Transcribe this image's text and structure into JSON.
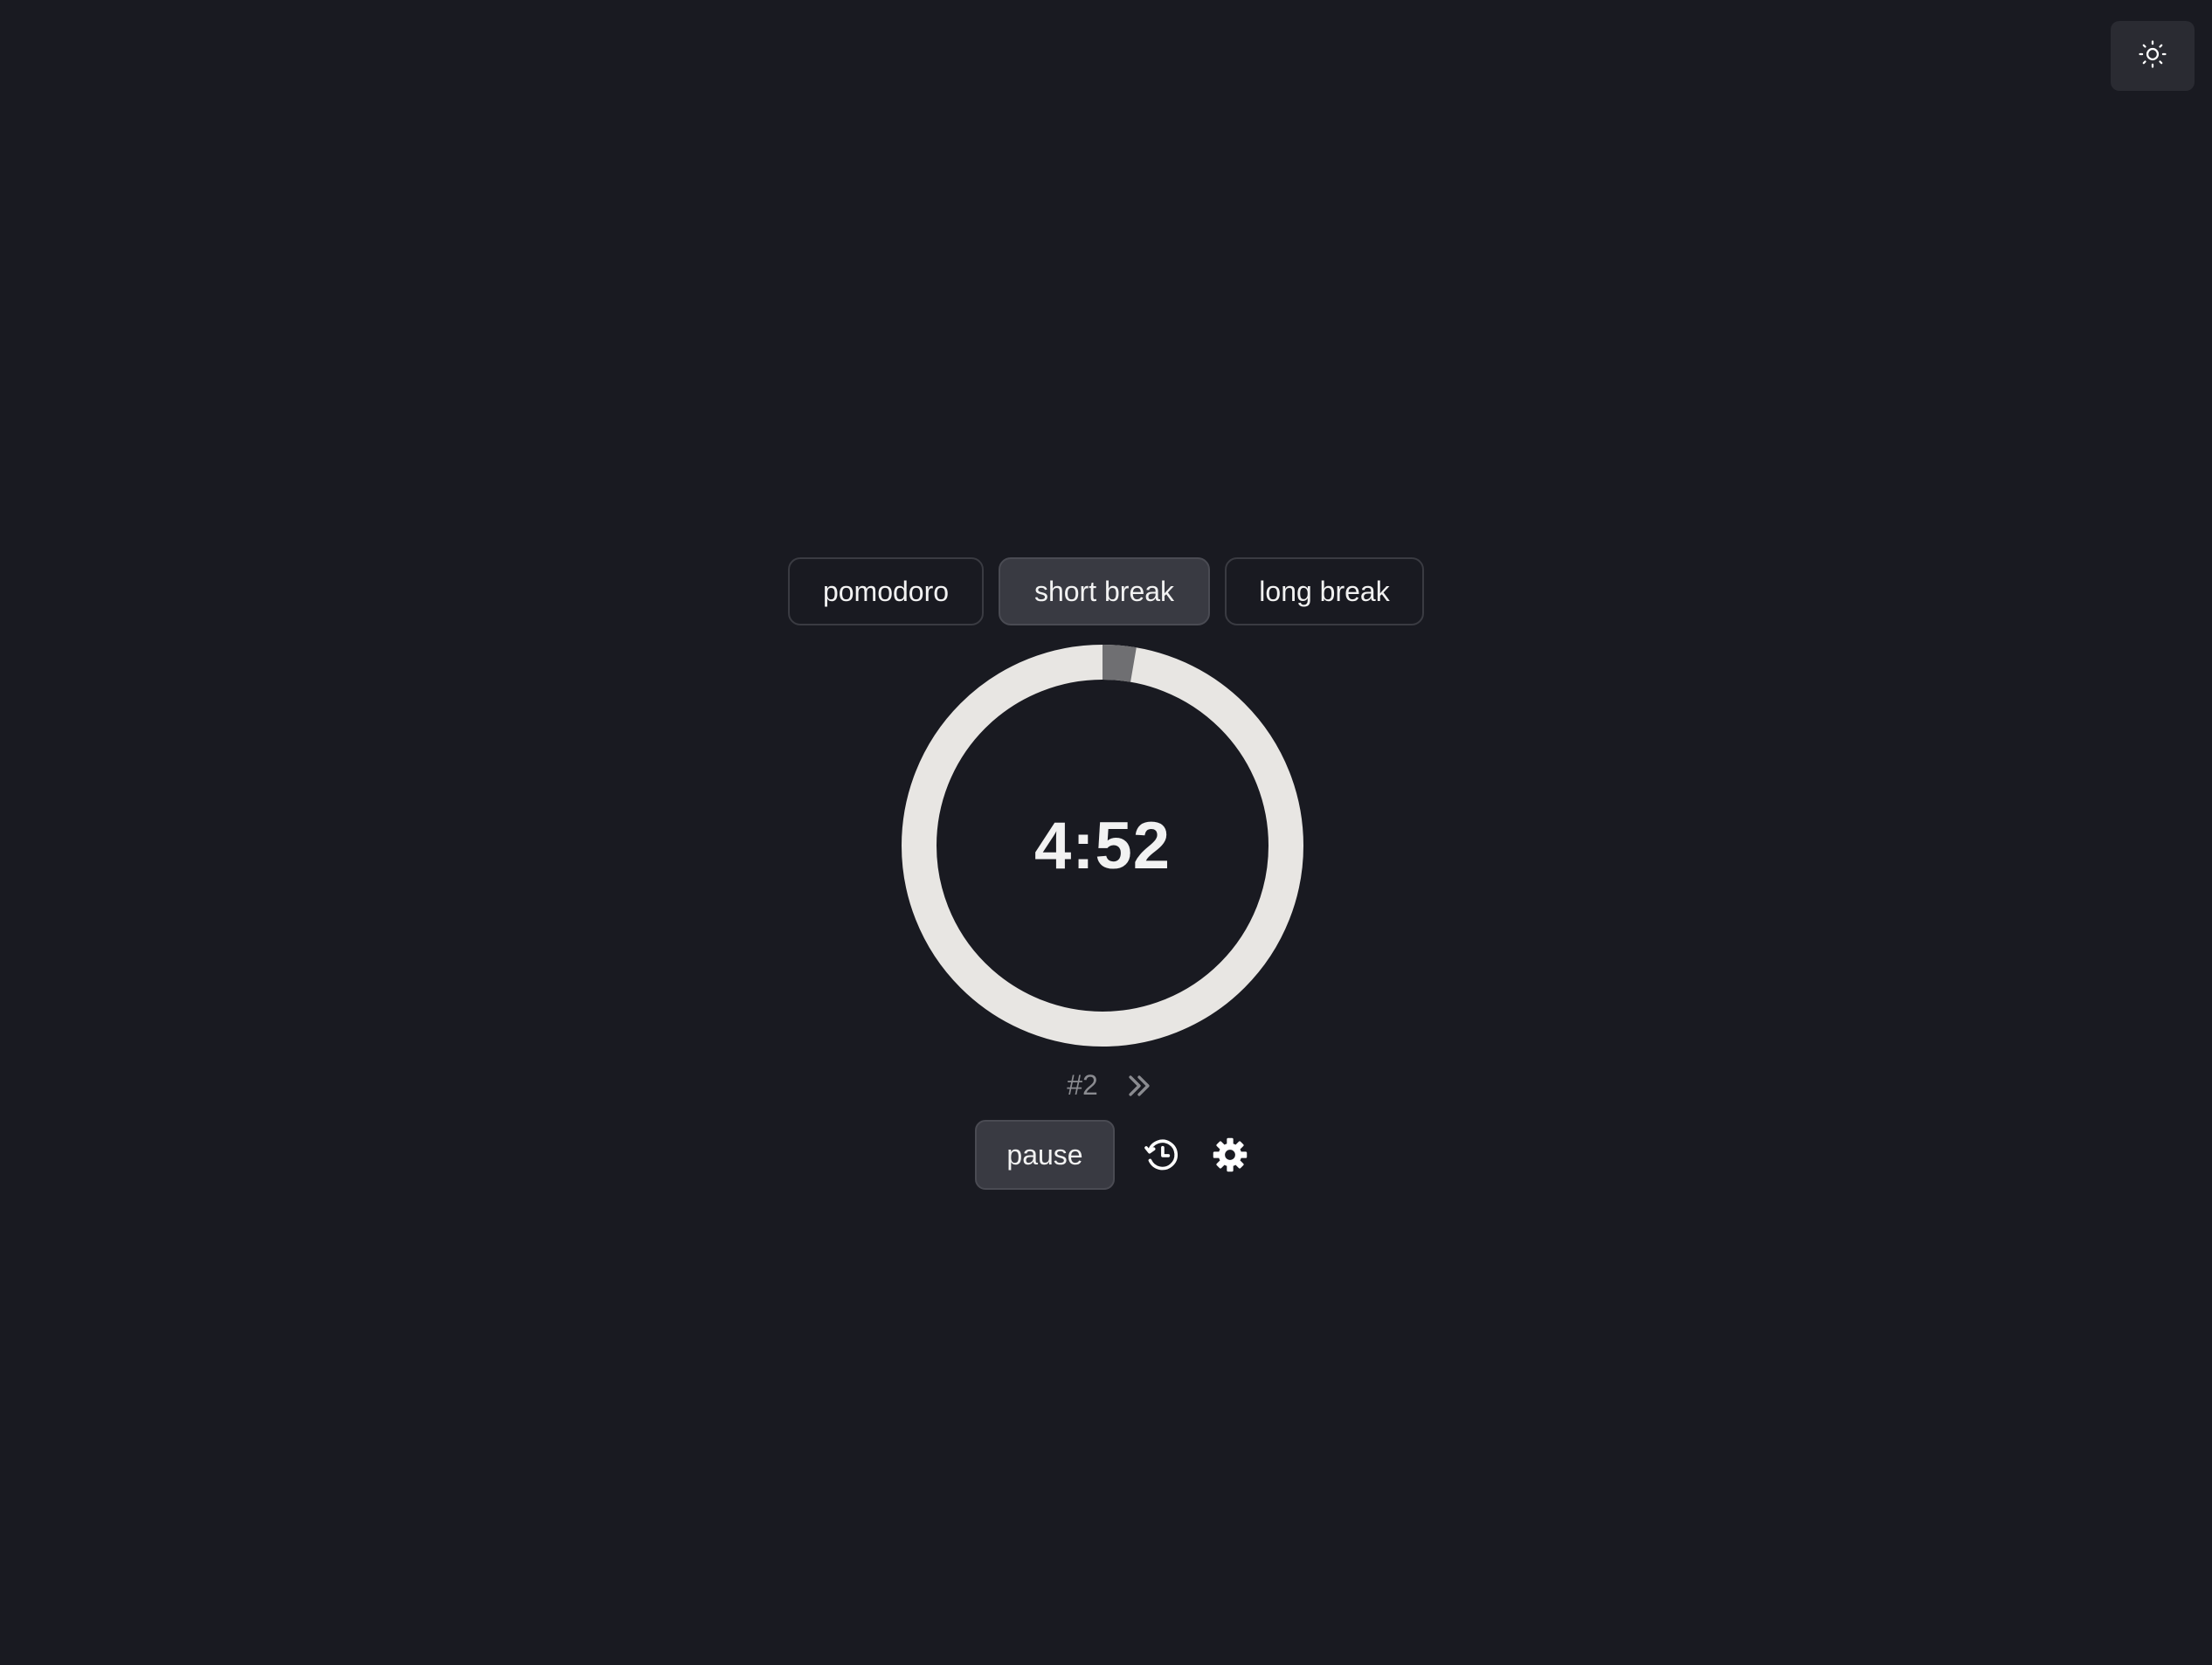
{
  "theme_toggle": {
    "icon": "sun-icon"
  },
  "modes": {
    "tabs": [
      {
        "label": "pomodoro",
        "active": false
      },
      {
        "label": "short break",
        "active": true
      },
      {
        "label": "long break",
        "active": false
      }
    ]
  },
  "timer": {
    "display": "4:52",
    "elapsed_fraction": 0.027
  },
  "session": {
    "count_label": "#2",
    "skip_icon": "double-chevron-right-icon"
  },
  "controls": {
    "pause_label": "pause",
    "history_icon": "history-icon",
    "settings_icon": "gear-icon"
  },
  "colors": {
    "background": "#191a21",
    "ring_remaining": "#e8e6e3",
    "ring_elapsed": "#6f6f72",
    "active_tab": "#393a42"
  }
}
